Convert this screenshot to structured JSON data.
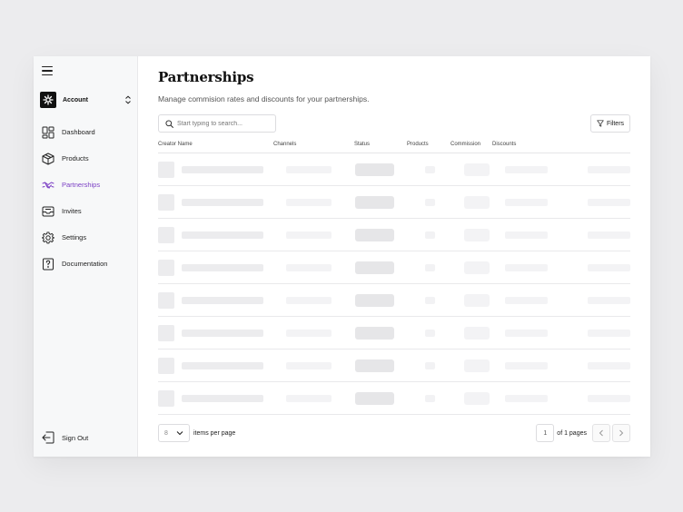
{
  "sidebar": {
    "account_label": "Account",
    "items": [
      {
        "label": "Dashboard",
        "icon": "dashboard-icon"
      },
      {
        "label": "Products",
        "icon": "box-icon"
      },
      {
        "label": "Partnerships",
        "icon": "handshake-icon",
        "active": true
      },
      {
        "label": "Invites",
        "icon": "inbox-icon"
      },
      {
        "label": "Settings",
        "icon": "gear-icon"
      },
      {
        "label": "Documentation",
        "icon": "help-icon"
      }
    ],
    "signout_label": "Sign Out"
  },
  "main": {
    "title": "Partnerships",
    "subtitle": "Manage commision rates and discounts for your partnerships.",
    "search_placeholder": "Start typing to search...",
    "filters_label": "Filters",
    "columns": [
      "Creator Name",
      "Channels",
      "Status",
      "Products",
      "Commission",
      "Discounts"
    ],
    "loading_rows": 8
  },
  "pagination": {
    "per_page_value": "8",
    "per_page_label": "items per page",
    "current_page": "1",
    "page_count_label": "of 1 pages"
  },
  "colors": {
    "accent": "#7b3fc4",
    "sidebar_bg": "#f7f8f9"
  }
}
